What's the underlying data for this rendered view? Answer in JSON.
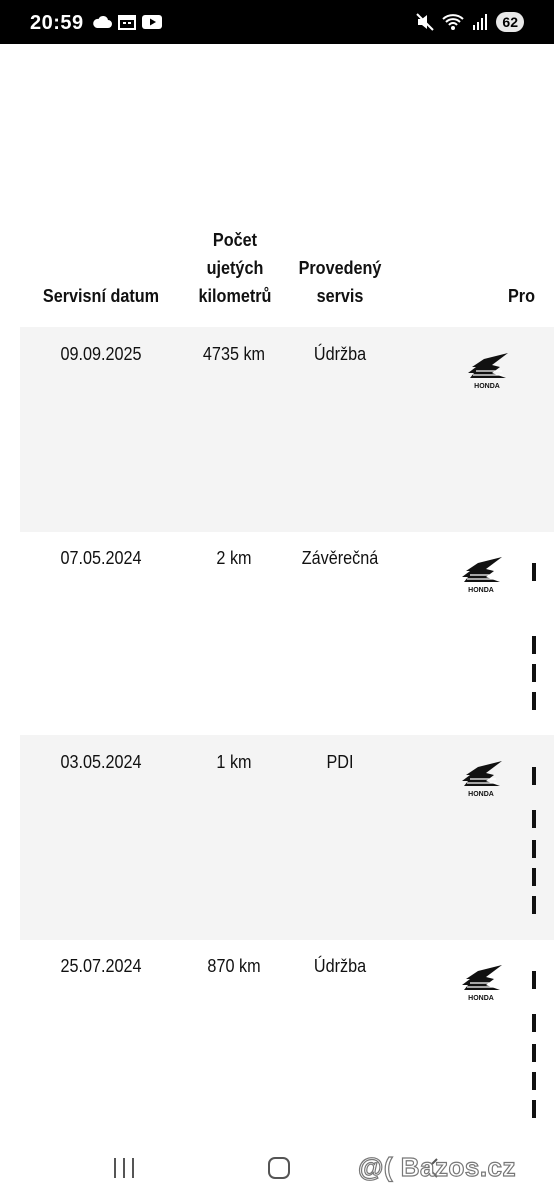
{
  "status_bar": {
    "time": "20:59",
    "battery": "62",
    "icons_left": [
      "cloud-icon",
      "calendar-icon",
      "youtube-icon"
    ],
    "icons_right": [
      "mute-icon",
      "wifi-icon",
      "signal-icon",
      "battery-icon"
    ]
  },
  "table": {
    "headers": {
      "date": "Servisní datum",
      "km": "Počet\nujetých\nkilometrů",
      "service": "Provedený\nservis",
      "partial": "Pro"
    },
    "rows": [
      {
        "date": "09.09.2025",
        "km": "4735 km",
        "service": "Údržba",
        "logo": "HONDA"
      },
      {
        "date": "07.05.2024",
        "km": "2 km",
        "service": "Závěrečná",
        "logo": "HONDA"
      },
      {
        "date": "03.05.2024",
        "km": "1 km",
        "service": "PDI",
        "logo": "HONDA"
      },
      {
        "date": "25.07.2024",
        "km": "870 km",
        "service": "Údržba",
        "logo": "HONDA"
      }
    ]
  },
  "nav_bar": {
    "buttons": [
      "recent-apps-button",
      "home-button",
      "back-button"
    ]
  },
  "watermark": "@( Bazos.cz"
}
